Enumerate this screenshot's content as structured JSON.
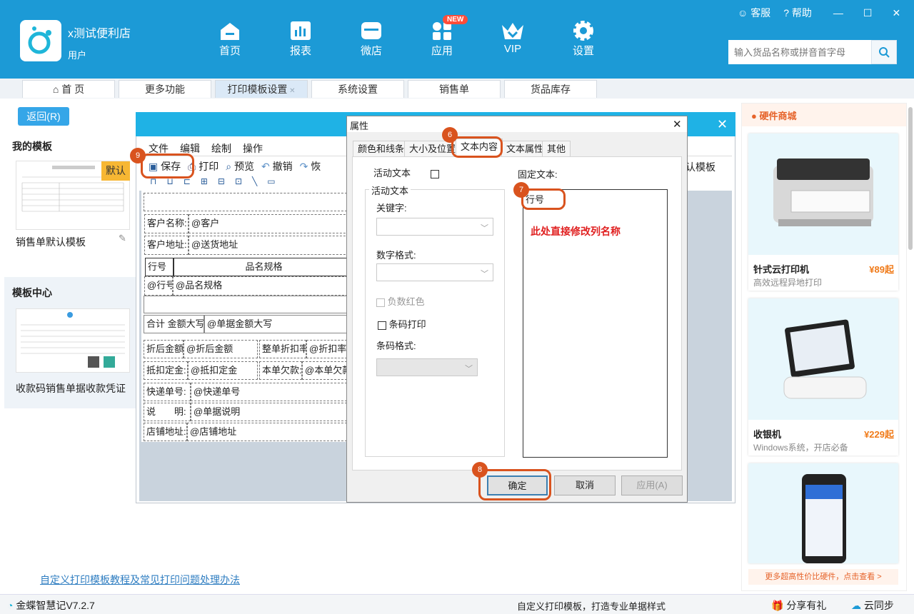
{
  "app": {
    "shop_name": "x测试便利店",
    "user_role": "用户",
    "version": "金蝶智慧记V7.2.7"
  },
  "nav": [
    {
      "label": "首页",
      "icon": "home-icon"
    },
    {
      "label": "报表",
      "icon": "report-icon"
    },
    {
      "label": "微店",
      "icon": "store-icon"
    },
    {
      "label": "应用",
      "icon": "apps-icon",
      "badge": "NEW"
    },
    {
      "label": "VIP",
      "icon": "vip-crown-icon"
    },
    {
      "label": "设置",
      "icon": "gear-icon"
    }
  ],
  "topright": {
    "service": "客服",
    "help": "帮助"
  },
  "search": {
    "placeholder": "输入货品名称或拼音首字母"
  },
  "tabs": [
    "首 页",
    "更多功能",
    "打印模板设置",
    "系统设置",
    "销售单",
    "货品库存"
  ],
  "left": {
    "back": "返回(R)",
    "my_templates": "我的模板",
    "default_badge": "默认",
    "template1": "销售单默认模板",
    "template_center": "模板中心",
    "template2": "收款码销售单据收款凭证",
    "bottom_link": "自定义打印模板教程及常见打印问题处理办法"
  },
  "designer": {
    "menus": [
      "文件",
      "编辑",
      "绘制",
      "操作"
    ],
    "tools": {
      "save": "保存",
      "print": "打印",
      "preview": "预览",
      "undo": "撤销",
      "redo": "恢",
      "default_tpl": "认模板"
    },
    "fields": {
      "customer_label": "客户名称:",
      "customer_val": "@客户",
      "addr_label": "客户地址:",
      "addr_val": "@送货地址",
      "row_header": "行号",
      "spec_header": "品名规格",
      "row_val": "@行号",
      "spec_val": "@品名规格",
      "total_label": "合计 金额大写",
      "total_val": "@单据金额大写",
      "disc_label": "折后金额",
      "disc_val": "@折后金额",
      "rate_label": "整单折扣率",
      "rate_val": "@折扣率",
      "deduct_label": "抵扣定金:",
      "deduct_val": "@抵扣定金",
      "owed_label": "本单欠款:",
      "owed_val": "@本单欠款",
      "express_label": "快递单号:",
      "express_val": "@快递单号",
      "note_label": "说　　明:",
      "note_val": "@单据说明",
      "store_label": "店铺地址:",
      "store_val": "@店铺地址"
    }
  },
  "dialog": {
    "title": "属性",
    "tabs": [
      "颜色和线条",
      "大小及位置",
      "文本内容",
      "文本属性",
      "其他"
    ],
    "active_text": "活动文本",
    "group": "活动文本",
    "keyword": "关键字:",
    "number_format": "数字格式:",
    "negative_red": "负数红色",
    "barcode_print": "条码打印",
    "barcode_format": "条码格式:",
    "fixed_text": "固定文本:",
    "fixed_value": "行号",
    "annotation": "此处直接修改列名称",
    "ok": "确定",
    "cancel": "取消",
    "apply": "应用(A)"
  },
  "steps": {
    "s6": "6",
    "s7": "7",
    "s8": "8",
    "s9": "9"
  },
  "shop": {
    "header": "硬件商城",
    "items": [
      {
        "name": "针式云打印机",
        "price": "¥89起",
        "desc": "高效远程异地打印"
      },
      {
        "name": "收银机",
        "price": "¥229起",
        "desc": "Windows系统，开店必备"
      }
    ],
    "more": "更多超高性价比硬件，点击查看 >"
  },
  "status": {
    "center": "自定义打印模板，打造专业单据样式",
    "share": "分享有礼",
    "sync": "云同步"
  },
  "colors": {
    "brand": "#1c9ad6",
    "accent": "#d9531e"
  }
}
